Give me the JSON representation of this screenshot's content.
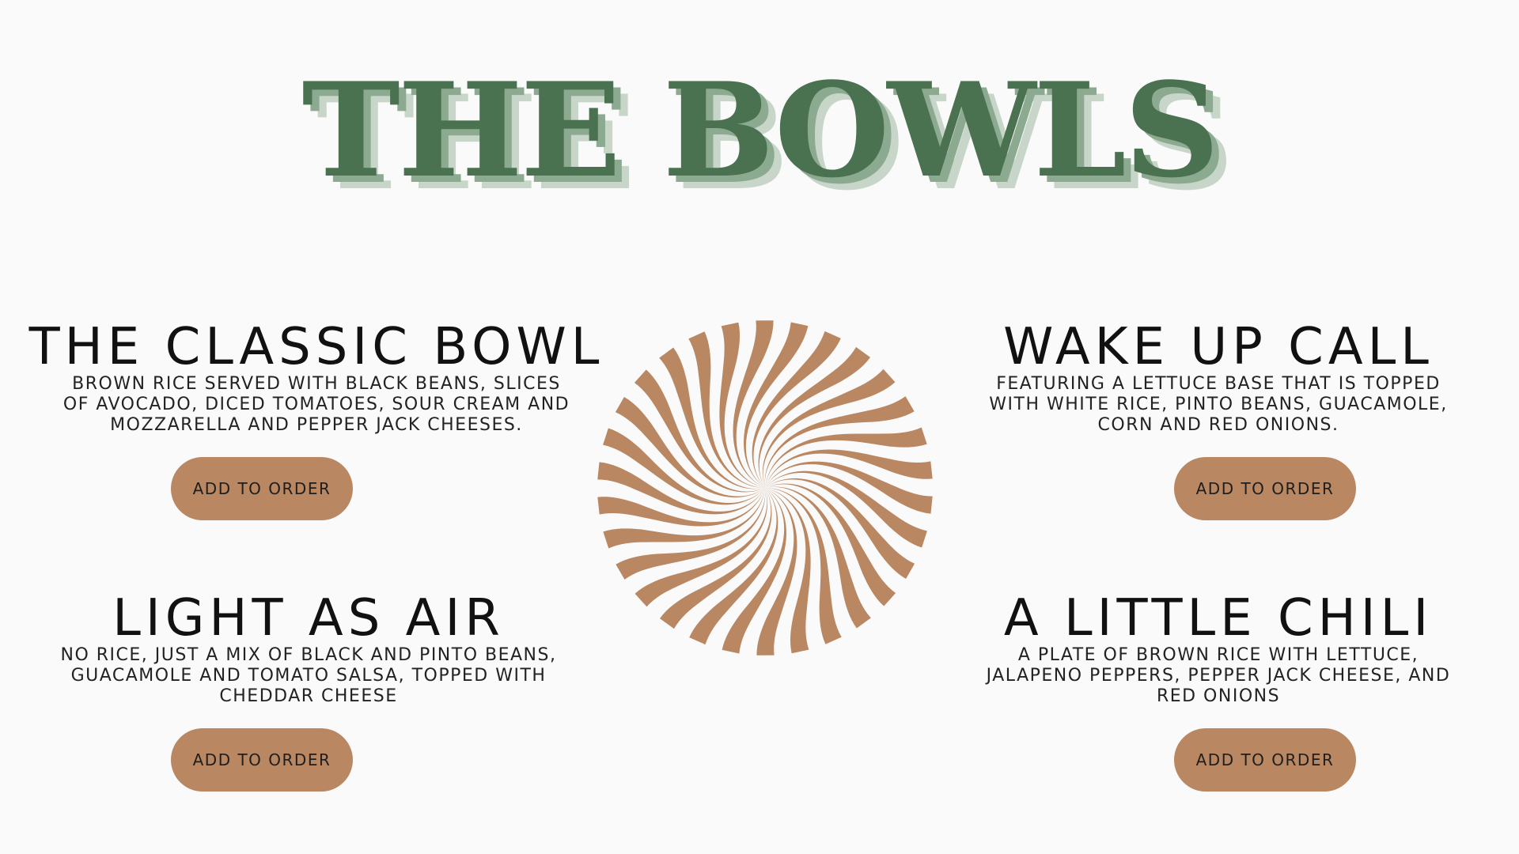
{
  "page": {
    "title": "THE BOWLS",
    "accent_color": "#4a7150",
    "button_color": "#b98761",
    "background_color": "#fafafa"
  },
  "menu": {
    "items": [
      {
        "title": "THE CLASSIC BOWL",
        "description": "BROWN RICE SERVED WITH BLACK BEANS, SLICES\nOF AVOCADO, DICED TOMATOES, SOUR CREAM AND\nMOZZARELLA AND PEPPER JACK CHEESES.",
        "button_label": "ADD TO ORDER"
      },
      {
        "title": "WAKE UP CALL",
        "description": "FEATURING A LETTUCE BASE THAT IS TOPPED\nWITH WHITE RICE, PINTO BEANS, GUACAMOLE,\nCORN AND RED ONIONS.",
        "button_label": "ADD TO ORDER"
      },
      {
        "title": "LIGHT AS AIR",
        "description": "NO RICE, JUST A MIX OF BLACK AND PINTO BEANS,\nGUACAMOLE AND TOMATO SALSA, TOPPED WITH\nCHEDDAR CHEESE",
        "button_label": "ADD TO ORDER"
      },
      {
        "title": "A LITTLE CHILI",
        "description": "A PLATE OF BROWN RICE WITH LETTUCE,\nJALAPENO PEPPERS, PEPPER JACK CHEESE, AND\nRED ONIONS",
        "button_label": "ADD TO ORDER"
      }
    ]
  },
  "decoration": {
    "icon": "swirl-icon",
    "color": "#b98761"
  }
}
